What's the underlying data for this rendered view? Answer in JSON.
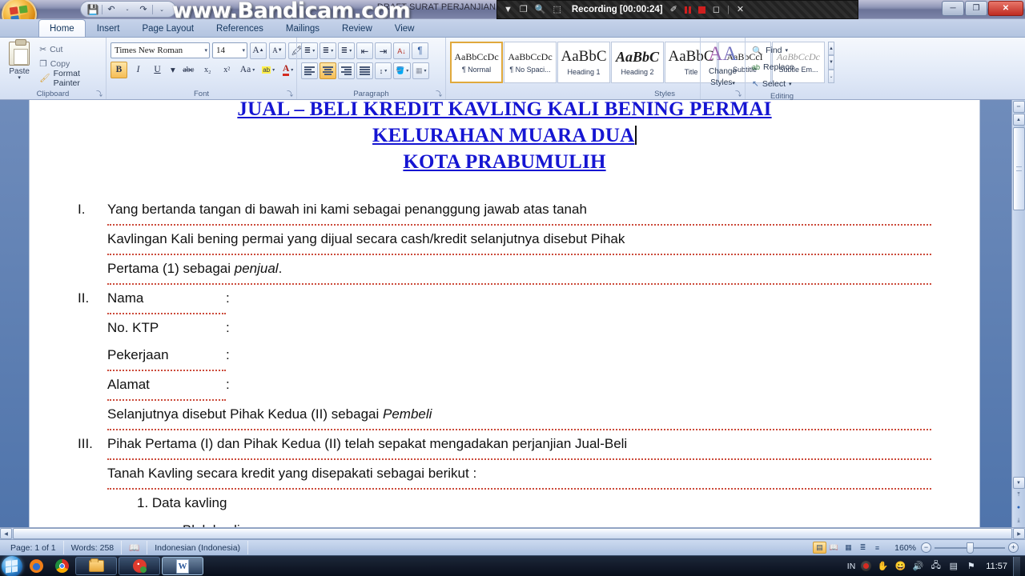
{
  "window": {
    "doc_title": "DRAFT SURAT PERJANJIAN [Compatibility Mode] - Microsoft Word",
    "minimize": "─",
    "restore": "❐",
    "close": "✕"
  },
  "quick_access": {
    "save_icon": "save-icon",
    "undo_icon": "undo-icon",
    "redo_icon": "redo-icon",
    "customize_icon": "chevron-down-icon",
    "save_glyph": "💾",
    "undo_glyph": "↶",
    "redo_glyph": "↷",
    "customize_glyph": "⌄"
  },
  "bandicam": {
    "watermark": "www.Bandicam.com",
    "recording_label": "Recording [00:00:24]",
    "icons": {
      "dropdown": "▼",
      "window": "❐",
      "magnify": "🔍",
      "region": "⬚",
      "pencil": "✐",
      "close": "✕",
      "separator": "|"
    }
  },
  "tabs": [
    {
      "label": "Home",
      "active": true
    },
    {
      "label": "Insert",
      "active": false
    },
    {
      "label": "Page Layout",
      "active": false
    },
    {
      "label": "References",
      "active": false
    },
    {
      "label": "Mailings",
      "active": false
    },
    {
      "label": "Review",
      "active": false
    },
    {
      "label": "View",
      "active": false
    }
  ],
  "ribbon": {
    "clipboard": {
      "group_label": "Clipboard",
      "paste_label": "Paste",
      "paste_arrow": "▾",
      "items": [
        {
          "label": "Cut",
          "glyph": "✂"
        },
        {
          "label": "Copy",
          "glyph": "❐"
        },
        {
          "label": "Format Painter",
          "glyph": "🖌"
        }
      ]
    },
    "font": {
      "group_label": "Font",
      "font_name": "Times New Roman",
      "font_size": "14",
      "grow_font": "A",
      "shrink_font": "A",
      "clear_formatting": "🖍",
      "bold": "B",
      "italic": "I",
      "underline": "U",
      "strikethrough": "abc",
      "subscript": "x₂",
      "superscript": "x²",
      "change_case": "Aa",
      "highlight": "ab",
      "font_color": "A",
      "caret": "▾"
    },
    "paragraph": {
      "group_label": "Paragraph",
      "bullets": "≣",
      "numbering": "≣",
      "multilevel": "≣",
      "decrease_indent": "⇤",
      "increase_indent": "⇥",
      "sort": "A↓",
      "show_marks": "¶",
      "align_left": "align-left",
      "align_center": "align-center",
      "align_right": "align-right",
      "justify": "justify",
      "line_spacing": "↕",
      "shading": "🪣",
      "borders": "▦",
      "caret": "▾"
    },
    "styles": {
      "group_label": "Styles",
      "cards": [
        {
          "preview": "AaBbCcDc",
          "name": "¶ Normal",
          "selected": true
        },
        {
          "preview": "AaBbCcDc",
          "name": "¶ No Spaci...",
          "selected": false
        },
        {
          "preview": "AaBbC",
          "name": "Heading 1",
          "selected": false
        },
        {
          "preview": "AaBbC",
          "name": "Heading 2",
          "selected": false
        },
        {
          "preview": "AaBbC",
          "name": "Title",
          "selected": false
        },
        {
          "preview": "AaBbCcI",
          "name": "Subtitle",
          "selected": false
        },
        {
          "preview": "AaBbCcDc",
          "name": "Subtle Em...",
          "selected": false
        }
      ],
      "scroll_up": "▲",
      "scroll_down": "▼",
      "more": "⌄"
    },
    "change_styles": {
      "label_line1": "Change",
      "label_line2": "Styles",
      "icon_text": "AA",
      "caret": "▾"
    },
    "editing": {
      "group_label": "Editing",
      "items": [
        {
          "label": "Find",
          "glyph": "🔍",
          "caret": "▾"
        },
        {
          "label": "Replace",
          "glyph": "ab",
          "caret": ""
        },
        {
          "label": "Select",
          "glyph": "↖",
          "caret": "▾"
        }
      ]
    },
    "dialog_launcher": "⤵"
  },
  "document": {
    "title_lines": [
      "JUAL – BELI KREDIT KAVLING KALI BENING PERMAI",
      "KELURAHAN MUARA DUA",
      "KOTA PRABUMULIH"
    ],
    "clauses": [
      {
        "num": "I.",
        "lines": [
          "Yang bertanda tangan di bawah ini kami sebagai penanggung jawab atas tanah",
          "Kavlingan Kali bening permai yang dijual secara cash/kredit selanjutnya disebut Pihak",
          "Pertama (1) sebagai penjual."
        ]
      }
    ],
    "section_ii": {
      "num": "II.",
      "fields": [
        {
          "key": "Nama",
          "colon": ":",
          "value": ""
        },
        {
          "key": "No. KTP",
          "colon": ":",
          "value": ""
        },
        {
          "key": "Pekerjaan",
          "colon": ":",
          "value": ""
        },
        {
          "key": "Alamat",
          "colon": ":",
          "value": ""
        }
      ],
      "closing_plain": "Selanjutnya disebut Pihak Kedua (II) sebagai ",
      "closing_italic": "Pembeli"
    },
    "section_iii": {
      "num": "III.",
      "lines": [
        "Pihak Pertama (I) dan Pihak Kedua (II) telah sepakat mengadakan perjanjian Jual-Beli",
        "Tanah Kavling secara kredit yang disepakati sebagai berikut :"
      ],
      "sub_items": [
        {
          "label": "1. Data kavling"
        }
      ],
      "sub_sub_items": [
        {
          "label": "a. Blok kavling",
          "colon": ":"
        }
      ]
    },
    "italic_word_clause1": "penjual",
    "title_color": "#1515d2"
  },
  "status_bar": {
    "page": "Page: 1 of 1",
    "words": "Words: 258",
    "proofing_icon": "📖",
    "language": "Indonesian (Indonesia)",
    "zoom_percent": "160%",
    "zoom_out": "−",
    "zoom_in": "+",
    "view_buttons": [
      {
        "name": "print-layout",
        "glyph": "▤",
        "active": true
      },
      {
        "name": "full-screen-reading",
        "glyph": "📖",
        "active": false
      },
      {
        "name": "web-layout",
        "glyph": "▦",
        "active": false
      },
      {
        "name": "outline",
        "glyph": "≣",
        "active": false
      },
      {
        "name": "draft",
        "glyph": "≡",
        "active": false
      }
    ]
  },
  "scrollbars": {
    "up_arrow": "▲",
    "down_arrow": "▼",
    "left_arrow": "◀",
    "right_arrow": "▶",
    "prev_page": "⤒",
    "select_object": "●",
    "next_page": "⤓",
    "split_handle": "═"
  },
  "taskbar": {
    "start_label": "start-orb",
    "pinned": [
      {
        "name": "firefox",
        "kind": "icon"
      },
      {
        "name": "chrome",
        "kind": "icon"
      },
      {
        "name": "file-explorer",
        "kind": "task"
      },
      {
        "name": "bandicam",
        "kind": "task"
      },
      {
        "name": "microsoft-word",
        "kind": "task",
        "active": true,
        "letter": "W"
      }
    ],
    "tray": {
      "language": "IN",
      "record_icon": "record-icon",
      "hand_icon": "✋",
      "smiley_icon": "😀",
      "volume_icon": "🔊",
      "network_icon": "🖧",
      "monitor_icon": "▤",
      "flag_icon": "⚑",
      "time": "11:57"
    }
  }
}
